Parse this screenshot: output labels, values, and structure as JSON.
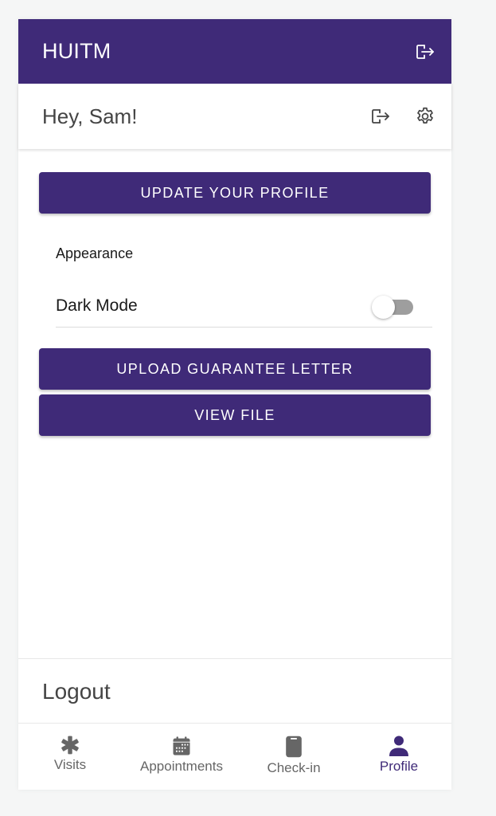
{
  "app": {
    "title": "HUITM",
    "brand_color": "#3f2a78"
  },
  "header": {
    "greeting": "Hey, Sam!",
    "topbar_icon": "logout-icon",
    "icons": [
      "logout-icon",
      "gear-icon"
    ]
  },
  "profile": {
    "update_button": "UPDATE YOUR PROFILE",
    "appearance_label": "Appearance",
    "dark_mode_label": "Dark Mode",
    "dark_mode_enabled": false,
    "upload_button": "UPLOAD GUARANTEE LETTER",
    "view_file_button": "VIEW FILE"
  },
  "logout": {
    "label": "Logout"
  },
  "bottom_nav": {
    "items": [
      {
        "label": "Visits",
        "icon": "asterisk-icon",
        "active": false
      },
      {
        "label": "Appointments",
        "icon": "calendar-icon",
        "active": false
      },
      {
        "label": "Check-in",
        "icon": "clipboard-icon",
        "active": false
      },
      {
        "label": "Profile",
        "icon": "person-icon",
        "active": true
      }
    ]
  }
}
